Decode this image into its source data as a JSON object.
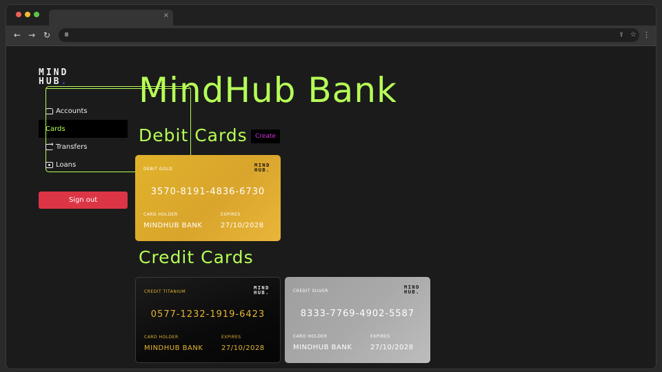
{
  "browser": {
    "tab_close": "×",
    "back_icon": "arrow-left-icon",
    "forward_icon": "arrow-right-icon",
    "reload_icon": "reload-icon"
  },
  "logo": {
    "line1": "MIND",
    "line2": "HUB",
    "dot": "."
  },
  "sidebar": {
    "items": [
      {
        "label": "Accounts",
        "icon": "bank-icon",
        "active": false
      },
      {
        "label": "Cards",
        "icon": "credit-card-icon",
        "active": true
      },
      {
        "label": "Transfers",
        "icon": "transfer-icon",
        "active": false
      },
      {
        "label": "Loans",
        "icon": "cash-icon",
        "active": false
      }
    ],
    "signout_label": "Sign out"
  },
  "main": {
    "title": "MindHub Bank",
    "debit_title": "Debit Cards",
    "create_label": "Create",
    "credit_title": "Credit Cards"
  },
  "cards": {
    "debit": [
      {
        "type": "DEBIT GOLD",
        "number": "3570-8191-4836-6730",
        "holder_label": "CARD HOLDER",
        "holder": "MINDHUB BANK",
        "expires_label": "EXPIRES",
        "expires": "27/10/2028",
        "logo_line1": "MIND",
        "logo_line2": "HUB."
      }
    ],
    "credit": [
      {
        "type": "CREDIT TITANIUM",
        "number": "0577-1232-1919-6423",
        "holder_label": "CARD HOLDER",
        "holder": "MINDHUB BANK",
        "expires_label": "EXPIRES",
        "expires": "27/10/2028",
        "logo_line1": "MIND",
        "logo_line2": "HUB."
      },
      {
        "type": "CREDIT SILVER",
        "number": "8333-7769-4902-5587",
        "holder_label": "CARD HOLDER",
        "holder": "MINDHUB BANK",
        "expires_label": "EXPIRES",
        "expires": "27/10/2028",
        "logo_line1": "MIND",
        "logo_line2": "HUB."
      }
    ]
  },
  "colors": {
    "accent": "#b6ff57",
    "signout": "#dc3545",
    "create": "#d32ee0",
    "gold": "#dcaa2c",
    "titanium_text": "#e6b530"
  }
}
